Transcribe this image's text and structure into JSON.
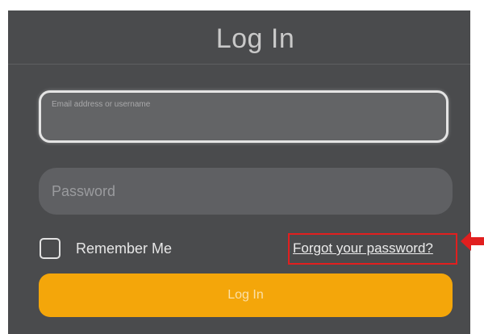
{
  "header": {
    "title": "Log In"
  },
  "form": {
    "email_placeholder": "Email address or username",
    "password_placeholder": "Password",
    "remember_label": "Remember Me",
    "remember_checked": false,
    "forgot_link": "Forgot your password?",
    "login_button": "Log In"
  },
  "annotation": {
    "highlight_color": "#e11f1f",
    "arrow_icon": "left-arrow-icon"
  },
  "colors": {
    "panel_bg": "#4a4b4d",
    "accent": "#f4a60a"
  }
}
